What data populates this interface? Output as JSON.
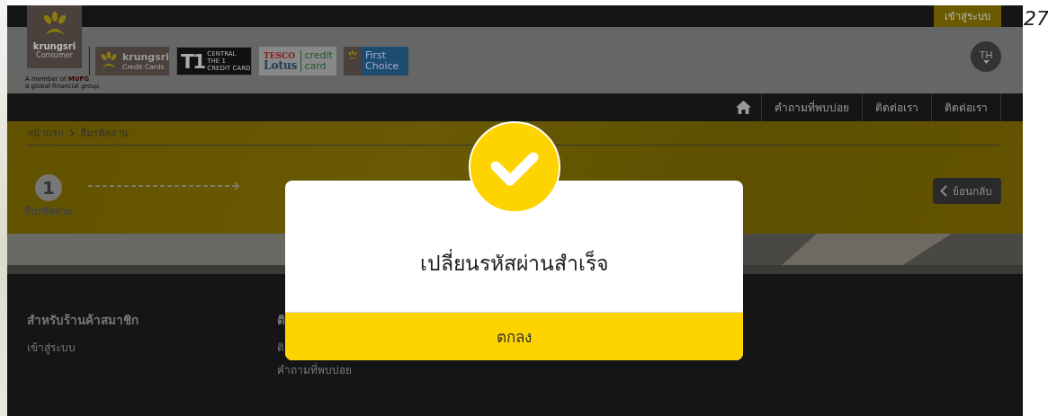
{
  "top_bar": {
    "login_button": "เข้าสู่ระบบ"
  },
  "corner_text": "27",
  "brand": {
    "name": "krungsri",
    "sub": "Consumer",
    "member_line": "A member of",
    "member_brand": "MUFG",
    "tagline": "a global financial group"
  },
  "partner_logos": [
    {
      "kind": "krungsri",
      "lines": [
        "krungsri",
        "Credit Cards"
      ]
    },
    {
      "kind": "t1",
      "mark": "T1",
      "lines": [
        "CENTRAL",
        "THE 1",
        "CREDIT CARD"
      ]
    },
    {
      "kind": "tesco",
      "lines": [
        "TESCO",
        "Lotus",
        "credit",
        "card"
      ]
    },
    {
      "kind": "firstchoice",
      "lines": [
        "First",
        "Choice"
      ]
    }
  ],
  "language": "TH",
  "nav": {
    "items": [
      "คำถามที่พบบ่อย",
      "ติดต่อเรา",
      "ติดต่อเรา"
    ]
  },
  "breadcrumb": [
    "หน้าแรก",
    "ลืมรหัสผ่าน"
  ],
  "steps": [
    {
      "number": "1",
      "label": "ลืมรหัสผ่าน"
    }
  ],
  "back_button": "ย้อนกลับ",
  "footer": {
    "columns": [
      {
        "heading": "สำหรับร้านค้าสมาชิก",
        "links": [
          "เข้าสู่ระบบ"
        ]
      },
      {
        "heading": "ติ",
        "links": [
          "ติ",
          "คำถามที่พบบ่อย"
        ]
      }
    ]
  },
  "dialog": {
    "message": "เปลี่ยนรหัสผ่านสำเร็จ",
    "button": "ตกลง"
  }
}
